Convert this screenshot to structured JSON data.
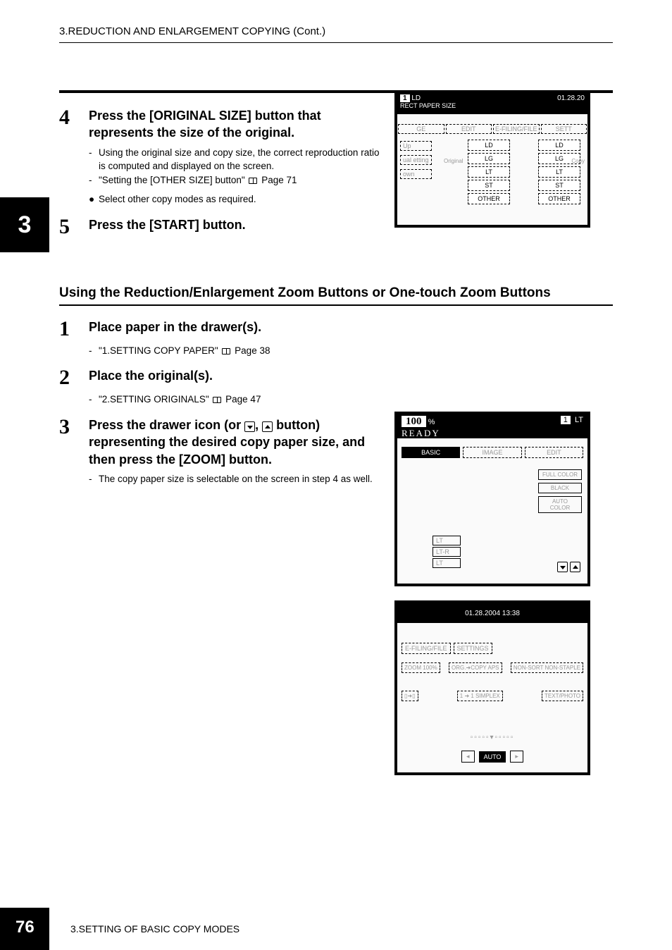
{
  "header": {
    "running_title": "3.REDUCTION AND ENLARGEMENT COPYING (Cont.)"
  },
  "side_tab": "3",
  "top_steps": [
    {
      "num": "4",
      "title": "Press the [ORIGINAL SIZE] button that represents the size of the original.",
      "lines": [
        "Using the original size and copy size, the correct reproduction ratio is computed and displayed on the screen.",
        "\"Setting the [OTHER SIZE] button\""
      ],
      "page_ref": "Page 71",
      "dot_line": "Select other copy modes as required."
    },
    {
      "num": "5",
      "title": "Press the [START] button."
    }
  ],
  "sub_heading": "Using the Reduction/Enlargement Zoom Buttons or One-touch Zoom Buttons",
  "sub_steps": [
    {
      "num": "1",
      "title": "Place paper in the drawer(s).",
      "line": "\"1.SETTING COPY PAPER\"",
      "page_ref": "Page 38"
    },
    {
      "num": "2",
      "title": "Place the original(s).",
      "line": "\"2.SETTING ORIGINALS\"",
      "page_ref": "Page 47"
    },
    {
      "num": "3",
      "title_a": "Press the drawer icon (or ",
      "title_b": ", ",
      "title_c": " button) representing the desired copy paper size, and then press the [ZOOM] button.",
      "line": "The copy paper size is selectable on the screen in step 4 as well."
    }
  ],
  "figure1": {
    "counter": "1",
    "status": "LD",
    "date": "01.28.20",
    "subtitle": "RECT PAPER SIZE",
    "tabs": [
      "GE",
      "EDIT",
      "E-FILING/FILE",
      "SETT"
    ],
    "left_buttons": [
      "Up",
      "ual etting",
      "own"
    ],
    "original_label": "Original",
    "copy_label": "Copy",
    "size_cols": {
      "original": [
        "LD",
        "LG",
        "LT",
        "ST",
        "OTHER"
      ],
      "copy": [
        "LD",
        "LG",
        "LT",
        "ST",
        "OTHER"
      ]
    }
  },
  "figure2": {
    "percent": "100",
    "percent_unit": "%",
    "counter": "1",
    "paper_ind": "LT",
    "status": "READY",
    "tabs": [
      "BASIC",
      "IMAGE",
      "EDIT"
    ],
    "active_tab": 0,
    "color_modes": [
      "FULL COLOR",
      "BLACK",
      "AUTO COLOR"
    ],
    "paper_sizes": [
      "LT",
      "LT-R",
      "LT"
    ]
  },
  "figure3": {
    "datetime": "01.28.2004 13:38",
    "tabs": [
      "E-FILING/FILE",
      "SETTINGS"
    ],
    "row1": {
      "left": "ZOOM 100%",
      "mid": "ORG.➜COPY APS",
      "right": "NON-SORT NON-STAPLE"
    },
    "row2": {
      "mid": "1 ➜ 1 SIMPLEX",
      "right": "TEXT/PHOTO"
    },
    "bottom": {
      "prev": "◂",
      "auto": "AUTO",
      "next": "▸"
    }
  },
  "footer": {
    "page_number": "76",
    "chapter": "3.SETTING OF BASIC COPY MODES"
  }
}
